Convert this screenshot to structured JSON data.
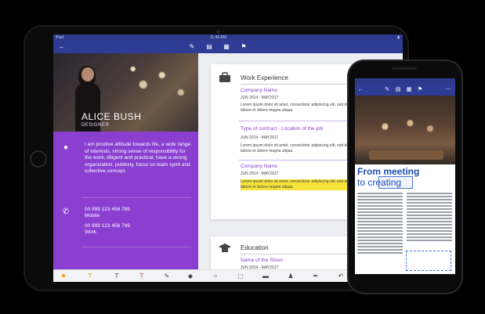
{
  "ipad": {
    "status": {
      "left": "iPad",
      "time": "11:46 AM",
      "right": ""
    },
    "resume": {
      "name": "ALICE BUSH",
      "role": "DESIGNER",
      "about": "I am positive attitude towards life, a wide range of interests, strong sense of responsibility for the work, diligent and practical, have a strong organization, publicity, focus on team spirit and collective concept.",
      "phone1": "00 999 123 456 789",
      "phone1_label": "Mobile",
      "phone2": "00 999 123 456 789",
      "phone2_label": "Work"
    },
    "work": {
      "section_title": "Work Experience",
      "job1": {
        "title": "Company Name",
        "date": "JUN 2014 - MAY2017",
        "text": "Lorem ipsum dolor sit amet, consectetur adipiscing elit, sed do eu tempor incididunt ut labore et dolore magna aliqua."
      },
      "job2": {
        "title": "Type of contract - Location of the job",
        "date": "JUN 2014 - MAY2017",
        "text": "Lorem ipsum dolor sit amet, consectetur adipiscing elit, sed do eu tempor incididunt ut labore et dolore magna aliqua."
      },
      "job3": {
        "title": "Company Name",
        "date": "JUN 2014 - MAY2017",
        "text": "Lorem ipsum dolor sit amet, consectetur adipiscing elit, sed do eu tempor incididunt ut labore et dolore magna aliqua."
      }
    },
    "education": {
      "section_title": "Education",
      "school": "Name of the Shool",
      "date": "JUN 2014 - MAY2017"
    }
  },
  "iphone": {
    "heading_line1": "From meeting",
    "heading_to": "to",
    "heading_selected": "creating"
  },
  "colors": {
    "toolbar": "#2f3c96",
    "sidebar": "#8a3fd1",
    "accent_text": "#8a3fd1",
    "highlight": "#f7e43a",
    "iphone_heading": "#1d4fb3"
  }
}
